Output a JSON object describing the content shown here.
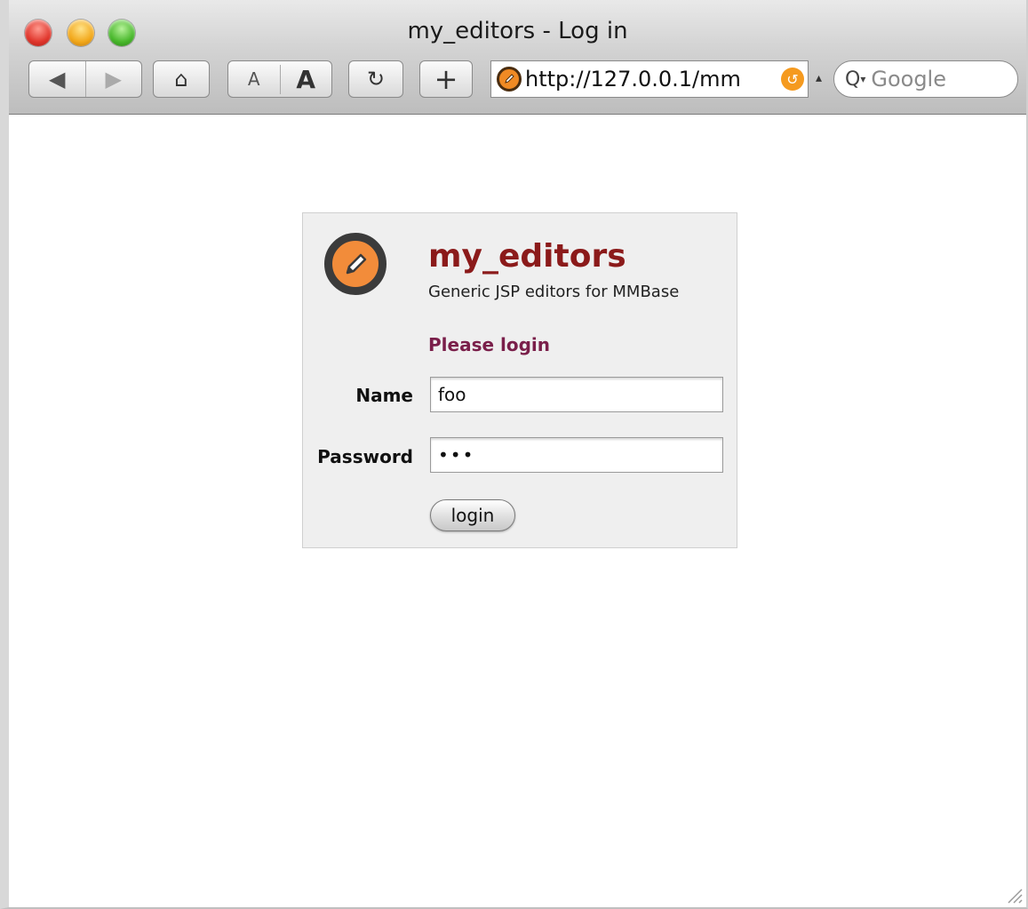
{
  "window": {
    "title": "my_editors - Log in"
  },
  "toolbar": {
    "back_icon": "back-arrow-icon",
    "back_glyph": "◀",
    "forward_glyph": "▶",
    "home_glyph": "⌂",
    "text_smaller_label": "A",
    "text_bigger_label": "A",
    "reload_glyph": "↻",
    "add_bookmark_glyph": "+",
    "url": "http://127.0.0.1/mm",
    "url_dropdown_glyph": "▴",
    "search_placeholder": "Google",
    "search_glyph": "Q",
    "search_caret_glyph": "▾"
  },
  "login": {
    "app_name": "my_editors",
    "app_description": "Generic JSP editors for MMBase",
    "prompt": "Please login",
    "name_label": "Name",
    "name_value": "foo",
    "password_label": "Password",
    "password_value": "•••",
    "submit_label": "login"
  },
  "colors": {
    "app_name": "#8b1a1a",
    "prompt": "#7a1f4a",
    "logo_fill": "#f28c3a",
    "logo_ring": "#3b3b3b"
  }
}
